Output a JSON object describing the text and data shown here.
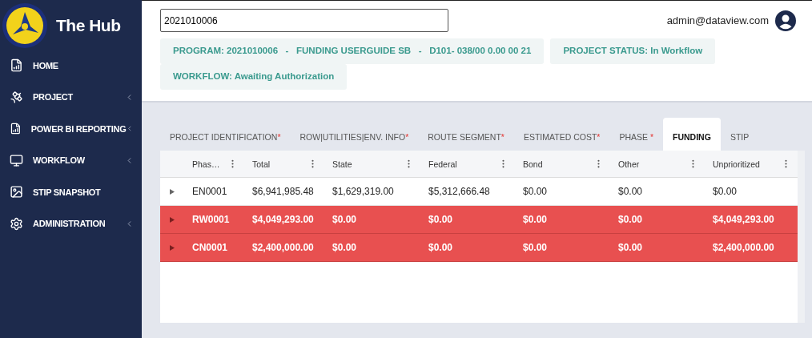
{
  "app": {
    "title": "The Hub"
  },
  "sidebar": {
    "items": [
      {
        "label": "HOME",
        "kind": "home",
        "expandable": false
      },
      {
        "label": "PROJECT",
        "kind": "project",
        "expandable": true
      },
      {
        "label": "POWER BI REPORTING",
        "kind": "report",
        "expandable": true
      },
      {
        "label": "WORKFLOW",
        "kind": "workflow",
        "expandable": true
      },
      {
        "label": "STIP SNAPSHOT",
        "kind": "snapshot",
        "expandable": false
      },
      {
        "label": "ADMINISTRATION",
        "kind": "admin",
        "expandable": true
      }
    ]
  },
  "header": {
    "search": {
      "value": "2021010006"
    },
    "user": "admin@dataview.com",
    "chips": [
      "PROGRAM: 2021010006   -   FUNDING USERGUIDE SB   -   D101- 038/00 0.00 00 21",
      "PROJECT STATUS: In Workflow",
      "WORKFLOW: Awaiting Authorization"
    ]
  },
  "tabs": [
    {
      "label": "PROJECT IDENTIFICATION",
      "mark": "*",
      "selected": false
    },
    {
      "label": "ROW|UTILITIES|ENV. INFO",
      "mark": "*",
      "selected": false
    },
    {
      "label": "ROUTE SEGMENT",
      "mark": "*",
      "selected": false
    },
    {
      "label": "ESTIMATED COST",
      "mark": "*",
      "selected": false
    },
    {
      "label": "PHASE ",
      "mark": "*",
      "selected": false
    },
    {
      "label": "FUNDING",
      "selected": true
    },
    {
      "label": "STIP",
      "selected": false
    }
  ],
  "table": {
    "columns": [
      "Phas…",
      "Total",
      "State",
      "Federal",
      "Bond",
      "Other",
      "Unprioritized"
    ],
    "rows": [
      {
        "flagged": false,
        "cells": [
          "EN0001",
          "$6,941,985.48",
          "$1,629,319.00",
          "$5,312,666.48",
          "$0.00",
          "$0.00",
          "$0.00"
        ]
      },
      {
        "flagged": true,
        "cells": [
          "RW0001",
          "$4,049,293.00",
          "$0.00",
          "$0.00",
          "$0.00",
          "$0.00",
          "$4,049,293.00"
        ]
      },
      {
        "flagged": true,
        "cells": [
          "CN0001",
          "$2,400,000.00",
          "$0.00",
          "$0.00",
          "$0.00",
          "$0.00",
          "$2,400,000.00"
        ]
      }
    ]
  }
}
